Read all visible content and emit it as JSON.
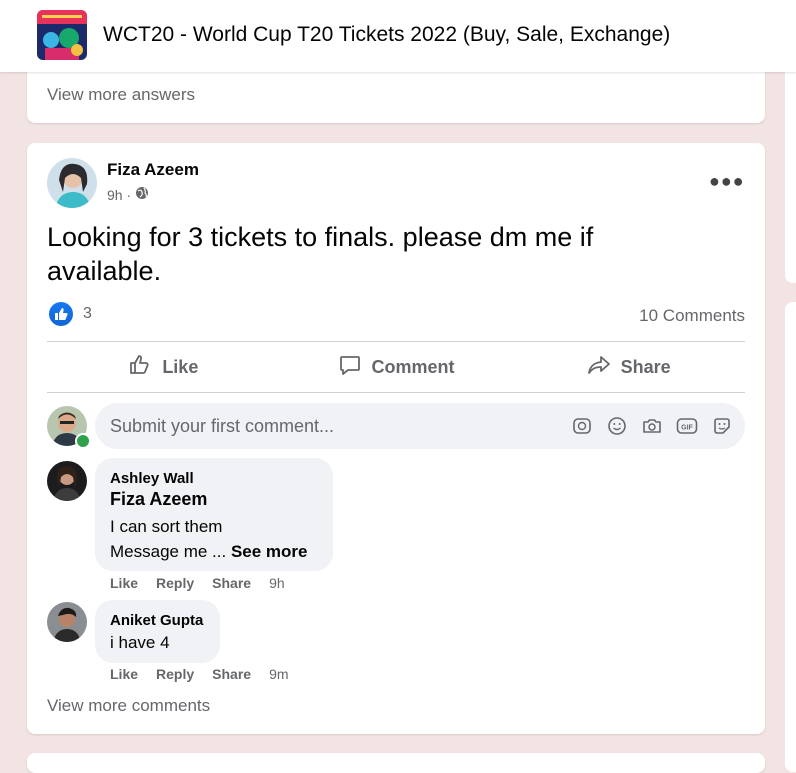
{
  "header": {
    "group_title": "WCT20 - World Cup T20 Tickets 2022 (Buy, Sale, Exchange)"
  },
  "previous_post": {
    "view_more_answers": "View more answers"
  },
  "post": {
    "author": "Fiza Azeem",
    "time": "9h ·",
    "privacy_icon": "globe-icon",
    "text": "Looking for 3 tickets to finals. please dm me if available.",
    "reaction_count": "3",
    "comments_count": "10 Comments",
    "actions": {
      "like": "Like",
      "comment": "Comment",
      "share": "Share"
    },
    "comment_input": {
      "placeholder": "Submit your first comment..."
    },
    "comments": [
      {
        "author": "Ashley Wall",
        "mention": "Fiza Azeem",
        "line1": "I can sort them",
        "line2": "Message me ...",
        "see_more": "See more",
        "like": "Like",
        "reply": "Reply",
        "share": "Share",
        "time": "9h"
      },
      {
        "author": "Aniket Gupta",
        "line1": "i have 4",
        "like": "Like",
        "reply": "Reply",
        "share": "Share",
        "time": "9m"
      }
    ],
    "view_more_comments": "View more comments"
  },
  "colors": {
    "brand_blue": "#1877f2",
    "muted_text": "#65676b",
    "online_green": "#31a24c",
    "page_background": "#f3e4e4"
  }
}
